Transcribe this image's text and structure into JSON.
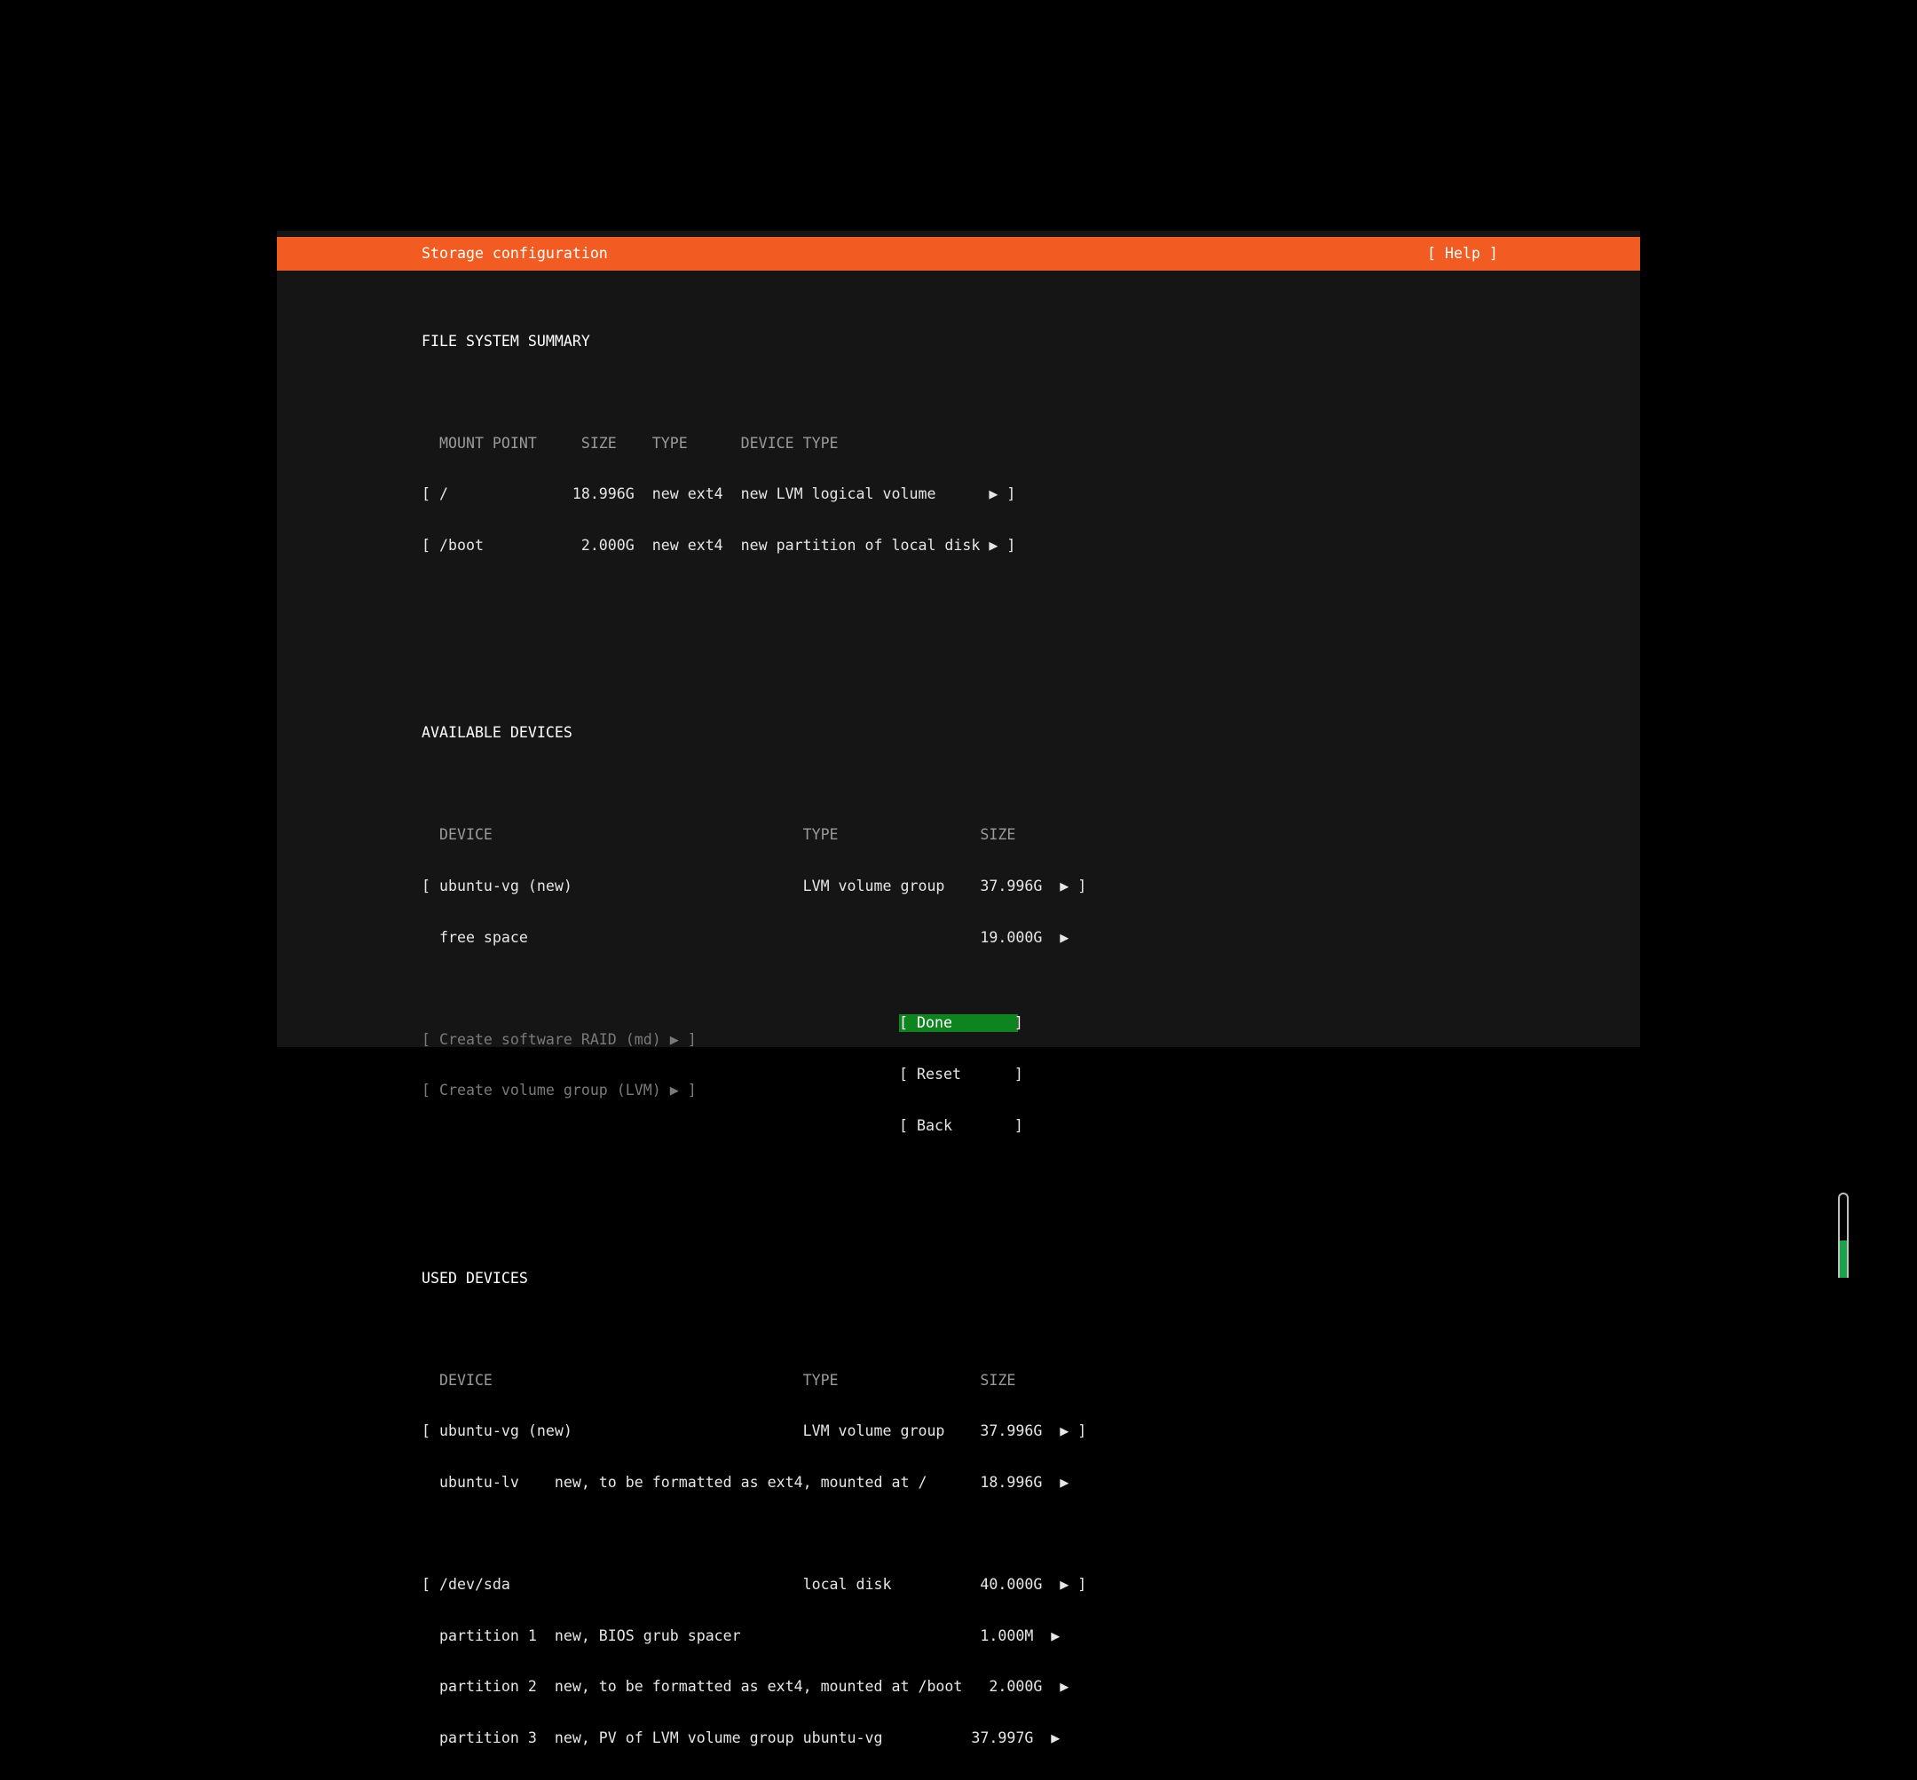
{
  "window": {
    "title": "Storage configuration",
    "help_label": "[ Help ]"
  },
  "fs_summary": {
    "heading": "FILE SYSTEM SUMMARY",
    "header": "  MOUNT POINT     SIZE    TYPE      DEVICE TYPE",
    "rows": [
      "[ /              18.996G  new ext4  new LVM logical volume      ▶ ]",
      "[ /boot           2.000G  new ext4  new partition of local disk ▶ ]"
    ]
  },
  "available_devices": {
    "heading": "AVAILABLE DEVICES",
    "header": "  DEVICE                                   TYPE                SIZE",
    "rows": [
      "[ ubuntu-vg (new)                          LVM volume group    37.996G  ▶ ]",
      "  free space                                                   19.000G  ▶"
    ],
    "actions": [
      "[ Create software RAID (md) ▶ ]",
      "[ Create volume group (LVM) ▶ ]"
    ]
  },
  "used_devices": {
    "heading": "USED DEVICES",
    "header": "  DEVICE                                   TYPE                SIZE",
    "rows": [
      "[ ubuntu-vg (new)                          LVM volume group    37.996G  ▶ ]",
      "  ubuntu-lv    new, to be formatted as ext4, mounted at /      18.996G  ▶",
      "[ /dev/sda                                 local disk          40.000G  ▶ ]",
      "  partition 1  new, BIOS grub spacer                           1.000M  ▶",
      "  partition 2  new, to be formatted as ext4, mounted at /boot   2.000G  ▶",
      "  partition 3  new, PV of LVM volume group ubuntu-vg          37.997G  ▶"
    ]
  },
  "buttons": {
    "done": "[ Done       ]",
    "reset": "[ Reset      ]",
    "back": "[ Back       ]"
  },
  "colors": {
    "accent": "#f25c22",
    "focus": "#0e8420",
    "background": "#151515"
  },
  "indicator": {
    "level_fraction": 0.45
  }
}
